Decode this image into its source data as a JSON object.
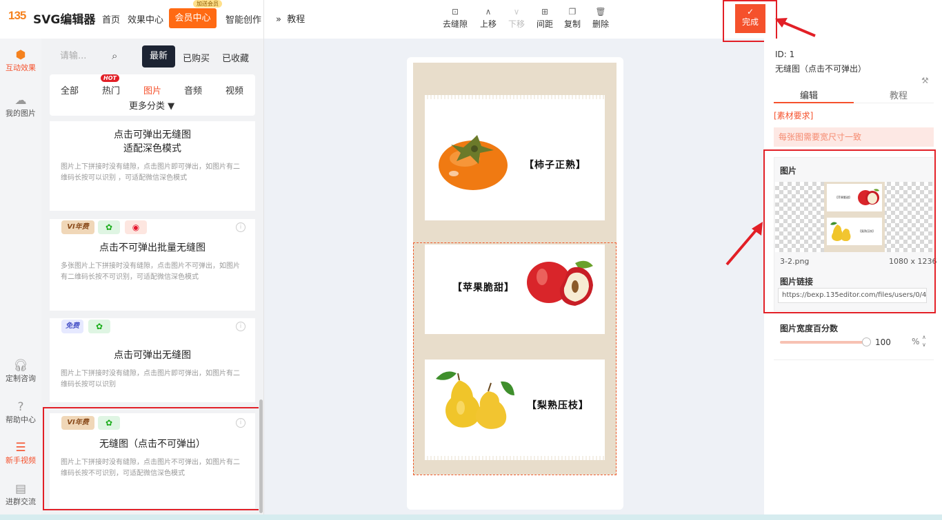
{
  "header": {
    "logo_mark": "135",
    "logo_text": "SVG编辑器",
    "nav": [
      "首页",
      "效果中心",
      "会员中心",
      "智能创作"
    ],
    "member_badge": "加送会员",
    "tutorial_link": "教程",
    "tutorial_chevron": "»",
    "tools": [
      {
        "label": "去缝隙",
        "icon": "gap-remove-icon",
        "disabled": false
      },
      {
        "label": "上移",
        "icon": "move-up-icon",
        "disabled": false
      },
      {
        "label": "下移",
        "icon": "move-down-icon",
        "disabled": true
      },
      {
        "label": "间距",
        "icon": "spacing-icon",
        "disabled": false
      },
      {
        "label": "复制",
        "icon": "copy-icon",
        "disabled": false
      },
      {
        "label": "删除",
        "icon": "delete-icon",
        "disabled": false
      }
    ],
    "done_label": "完成"
  },
  "rail": {
    "items": [
      {
        "label": "互动效果",
        "icon": "cube-icon",
        "active": true
      },
      {
        "label": "我的图片",
        "icon": "cloud-upload-icon",
        "active": false
      },
      {
        "label": "定制咨询",
        "icon": "headset-icon",
        "active": false
      },
      {
        "label": "帮助中心",
        "icon": "help-icon",
        "active": false
      },
      {
        "label": "新手视频",
        "icon": "video-icon",
        "active": true
      },
      {
        "label": "进群交流",
        "icon": "document-icon",
        "active": false
      }
    ]
  },
  "left_panel": {
    "search_placeholder": "请输...",
    "tabs": [
      "最新",
      "已购买",
      "已收藏"
    ],
    "categories": [
      "全部",
      "热门",
      "图片",
      "音频",
      "视频"
    ],
    "active_category": "图片",
    "hot_badge": "HOT",
    "more": "更多分类 ▼",
    "cards": [
      {
        "title_lines": [
          "点击可弹出无缝图",
          "适配深色模式"
        ],
        "desc": "图片上下拼接时没有缝隙，点击图片即可弹出，如图片有二维码长按可以识别 ，可适配微信深色模式",
        "tags": []
      },
      {
        "title_lines": [
          "点击不可弹出批量无缝图"
        ],
        "desc": "多张图片上下拼接时没有缝隙，点击图片不可弹出，如图片有二维码长按不可识别，可适配微信深色模式",
        "tags": [
          "VI年费",
          "wx",
          "wb"
        ]
      },
      {
        "title_lines": [
          "点击可弹出无缝图"
        ],
        "desc": "图片上下拼接时没有缝隙，点击图片即可弹出，如图片有二维码长按可以识别",
        "tags": [
          "免费",
          "wx"
        ]
      },
      {
        "title_lines": [
          "无缝图（点击不可弹出）"
        ],
        "desc": "图片上下拼接时没有缝隙，点击图片不可弹出，如图片有二维码长按不可识别，可适配微信深色模式",
        "tags": [
          "VI年费",
          "wx"
        ]
      }
    ],
    "tag_icons": {
      "wx": "wechat-icon",
      "wb": "weibo-icon"
    }
  },
  "canvas": {
    "frames": [
      {
        "label": "【柿子正熟】",
        "fruit": "persimmon"
      },
      {
        "label": "【苹果脆甜】",
        "fruit": "apple"
      },
      {
        "label": "【梨熟压枝】",
        "fruit": "pear"
      }
    ],
    "poster_bg": "#e8ddcb"
  },
  "right_panel": {
    "id_text": "ID: 1",
    "name": "无缝图（点击不可弹出）",
    "tabs": [
      "编辑",
      "教程"
    ],
    "requirements_label": "[素材要求]",
    "note": "每张图需要宽尺寸一致",
    "image_label": "图片",
    "image_file": "3-2.png",
    "image_dims": "1080 x 1236",
    "thumb_labels": [
      "【苹果脆甜】",
      "【梨熟压枝】"
    ],
    "link_label": "图片链接",
    "link_value": "https://bexp.135editor.com/files/users/0/485/20",
    "width_label": "图片宽度百分数",
    "width_value": "100",
    "width_unit": "%",
    "width_fraction": 1.0
  },
  "colors": {
    "accent": "#f5512c",
    "member": "#ff6a13",
    "highlight": "#e21f26"
  }
}
